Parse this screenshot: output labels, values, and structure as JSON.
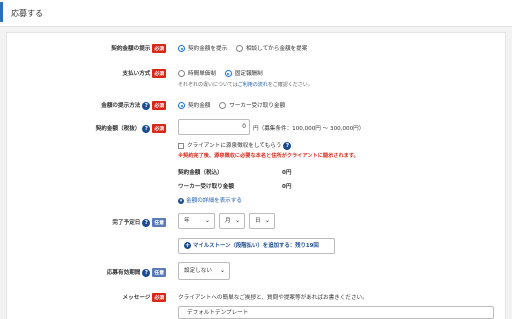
{
  "header": {
    "title": "応募する"
  },
  "fields": {
    "contract_amount_display": {
      "label": "契約金額の提示",
      "badge": "必須",
      "options": [
        "契約金額を提示",
        "相談してから金額を提案"
      ],
      "selected": 0
    },
    "payment_method": {
      "label": "支払い方式",
      "badge": "必須",
      "options": [
        "時間単価制",
        "固定報酬制"
      ],
      "selected": 1,
      "note_prefix": "それぞれの違いについては",
      "note_link": "ご利用の流れ",
      "note_suffix": "をご確認ください。"
    },
    "amount_method": {
      "label": "金額の提示方法",
      "badge": "必須",
      "options": [
        "契約金額",
        "ワーカー受け取り金額"
      ],
      "selected": 0
    },
    "contract_amount": {
      "label": "契約金額（税抜）",
      "badge": "必須",
      "value": "0",
      "unit": "円（募集条件：100,000円 〜 300,000円）",
      "receipt_checkbox": "クライアントに源泉徴収をしてもらう",
      "warning": "※契約完了後、源泉徴収に必要な本名と住所がクライアントに開示されます。",
      "summary": [
        {
          "label": "契約金額（税込）",
          "value": "0円"
        },
        {
          "label": "ワーカー受け取り金額",
          "value": "0円"
        }
      ],
      "details_link": "金額の詳細を表示する"
    },
    "due_date": {
      "label": "完了予定日",
      "badge": "任意",
      "year": "年",
      "month": "月",
      "day": "日",
      "milestone_button": "マイルストーン（段階払い）を追加する：残り19回"
    },
    "application_deadline": {
      "label": "応募有効期間",
      "badge": "任意",
      "value": "設定しない"
    },
    "message": {
      "label": "メッセージ",
      "badge": "必須",
      "placeholder_note": "クライアントへの簡単なご挨拶と、質問や提案等があればお書きください。",
      "template": "デフォルトテンプレート"
    }
  },
  "colors": {
    "required": "#d9281a",
    "optional": "#5a7bb5",
    "accent": "#1d4b8f",
    "header_bar": "#2a6fc0"
  }
}
